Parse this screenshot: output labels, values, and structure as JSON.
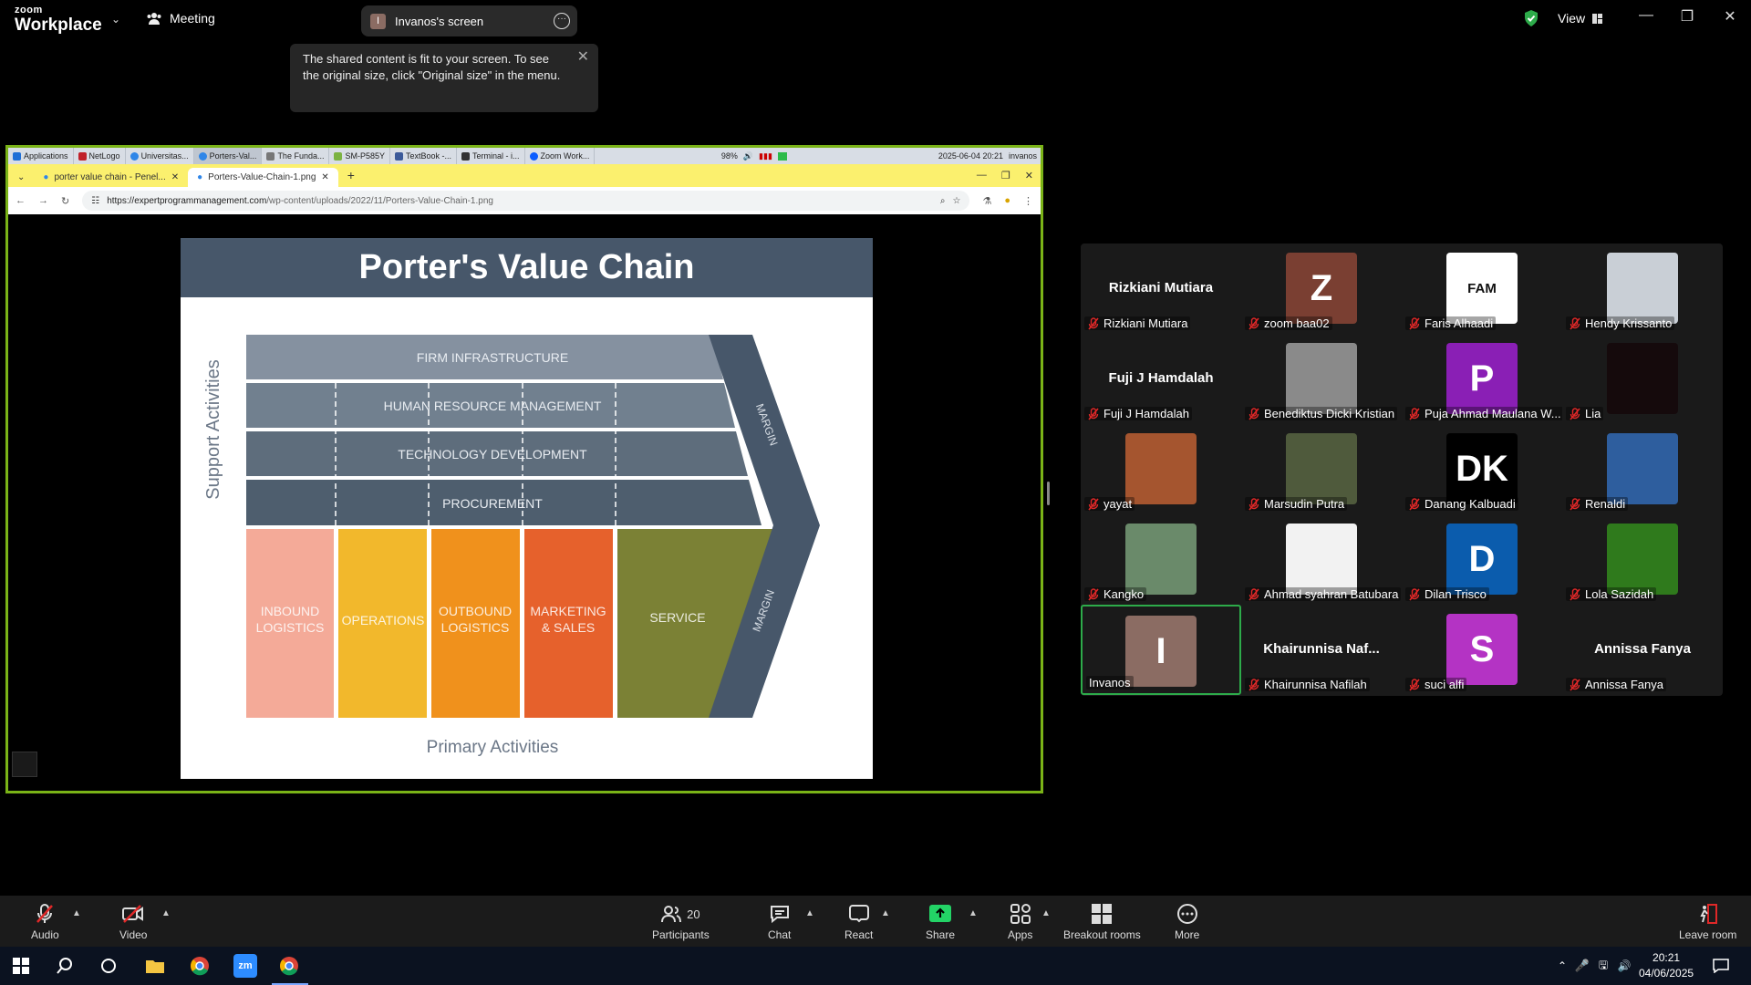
{
  "app": {
    "logo_top": "zoom",
    "logo_bottom": "Workplace",
    "meeting_label": "Meeting",
    "share_initial": "I",
    "share_title": "Invanos's screen",
    "view_label": "View"
  },
  "tooltip": {
    "text": "The shared content is fit to your screen. To see the original size, click \"Original size\" in the menu."
  },
  "shared_screen": {
    "taskbar_items": [
      "Applications",
      "NetLogo",
      "Universitas...",
      "Porters-Val...",
      "The Funda...",
      "SM-P585Y",
      "TextBook -...",
      "Terminal - i...",
      "Zoom Work..."
    ],
    "battery": "98%",
    "tray_datetime": "2025-06-04 20:21",
    "tray_user": "invanos",
    "tabs": [
      "porter value chain - Penel...",
      "Porters-Value-Chain-1.png"
    ],
    "url_domain": "https://expertprogrammanagement.com",
    "url_path": "/wp-content/uploads/2022/11/Porters-Value-Chain-1.png",
    "slide": {
      "title": "Porter's Value Chain",
      "support_label": "Support Activities",
      "primary_label": "Primary Activities",
      "support_rows": [
        "FIRM INFRASTRUCTURE",
        "HUMAN RESOURCE MANAGEMENT",
        "TECHNOLOGY DEVELOPMENT",
        "PROCUREMENT"
      ],
      "primary_cols": [
        {
          "l1": "INBOUND",
          "l2": "LOGISTICS",
          "color": "#f4aa98"
        },
        {
          "l1": "OPERATIONS",
          "l2": "",
          "color": "#f2b82c"
        },
        {
          "l1": "OUTBOUND",
          "l2": "LOGISTICS",
          "color": "#f0911c"
        },
        {
          "l1": "MARKETING",
          "l2": "& SALES",
          "color": "#e6612c"
        },
        {
          "l1": "SERVICE",
          "l2": "",
          "color": "#7b8135"
        }
      ],
      "margin_label": "MARGIN"
    }
  },
  "participants": [
    {
      "name": "Rizkiani Mutiara",
      "display": "Rizkiani Mutiara",
      "avatar": "",
      "color": ""
    },
    {
      "name": "zoom baa02",
      "display": "",
      "avatar": "Z",
      "color": "#7a3f32"
    },
    {
      "name": "Faris Alhaadi",
      "display": "",
      "avatar": "FAM",
      "color": "#ffffff"
    },
    {
      "name": "Hendy Krissanto",
      "display": "",
      "avatar": "",
      "color": "#c9cfd6"
    },
    {
      "name": "Fuji J Hamdalah",
      "display": "Fuji J Hamdalah",
      "avatar": "",
      "color": ""
    },
    {
      "name": "Benediktus Dicki Kristian",
      "display": "",
      "avatar": "",
      "color": "#8a8a8a"
    },
    {
      "name": "Puja Ahmad Maulana W...",
      "display": "",
      "avatar": "P",
      "color": "#8a1fb5"
    },
    {
      "name": "Lia",
      "display": "",
      "avatar": "",
      "color": "#150a0c"
    },
    {
      "name": "yayat",
      "display": "",
      "avatar": "",
      "color": "#a5552f"
    },
    {
      "name": "Marsudin Putra",
      "display": "",
      "avatar": "",
      "color": "#4f5a3c"
    },
    {
      "name": "Danang Kalbuadi",
      "display": "",
      "avatar": "DK",
      "color": "#000000"
    },
    {
      "name": "Renaldi",
      "display": "",
      "avatar": "",
      "color": "#2e5e9e"
    },
    {
      "name": "Kangko",
      "display": "",
      "avatar": "",
      "color": "#6a8a6a"
    },
    {
      "name": "Ahmad syahran Batubara",
      "display": "",
      "avatar": "",
      "color": "#f2f2f2"
    },
    {
      "name": "Dilan Trisco",
      "display": "",
      "avatar": "D",
      "color": "#0b5cad"
    },
    {
      "name": "Lola Sazidah",
      "display": "",
      "avatar": "",
      "color": "#2f7a1c"
    },
    {
      "name": "Invanos",
      "display": "",
      "avatar": "I",
      "color": "#8b6c63"
    },
    {
      "name": "Khairunnisa Nafilah",
      "display": "Khairunnisa  Naf...",
      "avatar": "",
      "color": ""
    },
    {
      "name": "suci alfi",
      "display": "",
      "avatar": "S",
      "color": "#b433c4"
    },
    {
      "name": "Annissa Fanya",
      "display": "Annissa Fanya",
      "avatar": "",
      "color": ""
    }
  ],
  "toolbar": {
    "audio": "Audio",
    "video": "Video",
    "participants_count": "20",
    "participants": "Participants",
    "chat": "Chat",
    "react": "React",
    "share": "Share",
    "apps": "Apps",
    "breakout": "Breakout rooms",
    "more": "More",
    "leave": "Leave room"
  },
  "windows": {
    "time": "20:21",
    "date": "04/06/2025"
  },
  "colors": {
    "share_border": "#7ab317",
    "active_speaker": "#2dab4a",
    "share_green": "#23d366",
    "mic_off_red": "#e02828"
  }
}
